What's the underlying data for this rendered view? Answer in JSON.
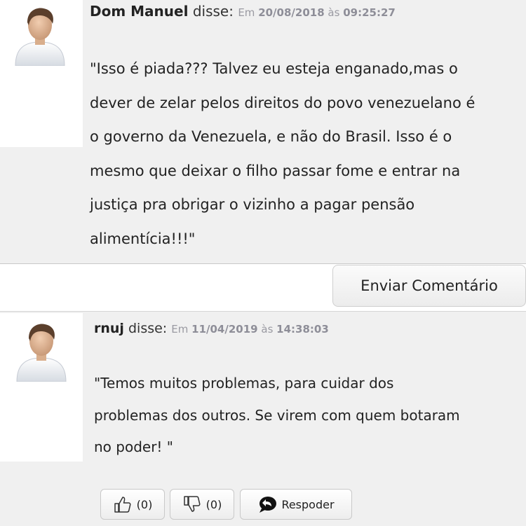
{
  "comments": [
    {
      "author": "Dom Manuel",
      "said": "disse:",
      "date_prefix": "Em",
      "date": "20/08/2018",
      "time_prefix": "às",
      "time": "09:25:27",
      "text": "\"Isso é piada??? Talvez eu esteja enganado,mas o\ndever de zelar pelos direitos do povo venezuelano é\no governo da Venezuela, e não do Brasil. Isso é o\nmesmo que deixar o filho passar fome e entrar na\njustiça pra obrigar o vizinho a pagar pensão\nalimentícia!!!\""
    },
    {
      "author": "rnuj",
      "said": "disse:",
      "date_prefix": "Em",
      "date": "11/04/2019",
      "time_prefix": "às",
      "time": "14:38:03",
      "text": "\"Temos muitos problemas, para cuidar dos\nproblemas dos outros. Se virem com quem botaram\nno poder! \""
    }
  ],
  "send_button": {
    "label": "Enviar Comentário"
  },
  "actions": {
    "like_count": "(0)",
    "dislike_count": "(0)",
    "reply_label": "Respoder"
  },
  "icons": {
    "avatar": "user-avatar-icon",
    "like": "thumbs-up-icon",
    "dislike": "thumbs-down-icon",
    "reply": "reply-bubble-icon"
  },
  "colors": {
    "block_background": "#f0f0f0",
    "meta_text": "#9a9aa2"
  }
}
